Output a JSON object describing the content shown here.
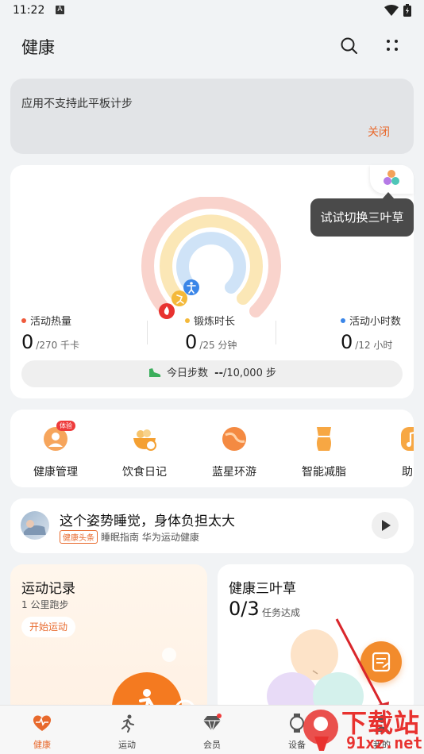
{
  "status_bar": {
    "time": "11:22",
    "notify_icon": "A"
  },
  "header": {
    "title": "健康"
  },
  "notice": {
    "text": "应用不支持此平板计步",
    "close_label": "关闭"
  },
  "rings": {
    "tooltip": "试试切换三叶草",
    "stats": [
      {
        "label": "活动热量",
        "value": "0",
        "unit": "/270 千卡",
        "color": "#ef5a3c"
      },
      {
        "label": "锻炼时长",
        "value": "0",
        "unit": "/25 分钟",
        "color": "#f4b93a"
      },
      {
        "label": "活动小时数",
        "value": "0",
        "unit": "/12 小时",
        "color": "#3b86e8"
      }
    ],
    "steps_label": "今日步数",
    "steps_value": "--",
    "steps_goal": "/10,000 步"
  },
  "services": [
    {
      "label": "健康管理",
      "badge": "体验"
    },
    {
      "label": "饮食日记"
    },
    {
      "label": "蓝星环游"
    },
    {
      "label": "智能减脂"
    },
    {
      "label": "助眠"
    }
  ],
  "article": {
    "title": "这个姿势睡觉，身体负担太大",
    "tag": "健康头条",
    "meta": "睡眠指南 华为运动健康"
  },
  "exercise": {
    "title": "运动记录",
    "subtitle": "1 公里跑步",
    "button": "开始运动"
  },
  "clover": {
    "title": "健康三叶草",
    "progress": "0/3",
    "subtitle": "任务达成"
  },
  "tabs": [
    {
      "label": "健康",
      "active": true
    },
    {
      "label": "运动"
    },
    {
      "label": "会员"
    },
    {
      "label": "设备"
    },
    {
      "label": "我的"
    }
  ],
  "watermark": {
    "text": "下载站",
    "domain": "91xz.net"
  },
  "colors": {
    "accent": "#e8692c",
    "ring_outer": "#f9d3cc",
    "ring_mid": "#fbe7b6",
    "ring_inner": "#cfe3f7"
  }
}
